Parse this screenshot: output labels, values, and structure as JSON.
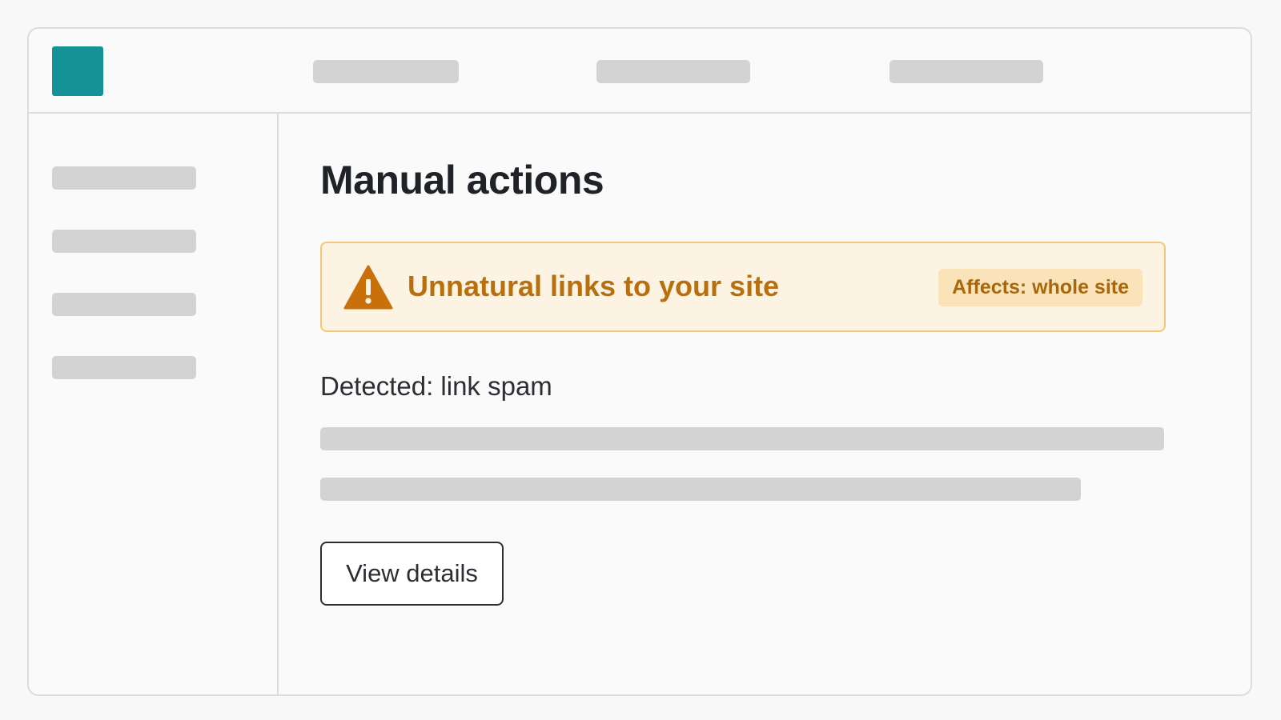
{
  "brand": {
    "logo_color": "#149296"
  },
  "main": {
    "page_title": "Manual actions",
    "alert": {
      "icon": "warning-triangle-icon",
      "icon_color": "#c9700a",
      "title": "Unnatural links to your site",
      "badge": "Affects: whole site",
      "background_color": "#fdf3e3",
      "border_color": "#f0c878",
      "text_color": "#b8700e"
    },
    "detected": "Detected: link spam",
    "view_details_label": "View details"
  }
}
